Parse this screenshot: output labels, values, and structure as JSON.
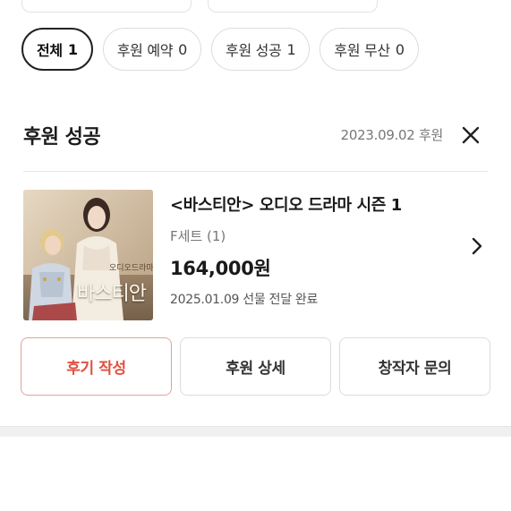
{
  "filter_tabs": [
    {
      "label": "전체",
      "count": "1",
      "active": true
    },
    {
      "label": "후원 예약",
      "count": "0",
      "active": false
    },
    {
      "label": "후원 성공",
      "count": "1",
      "active": false
    },
    {
      "label": "후원 무산",
      "count": "0",
      "active": false
    }
  ],
  "section": {
    "title": "후원 성공",
    "date": "2023.09.02 후원",
    "close_icon": "close-icon"
  },
  "item": {
    "title": "<바스티안> 오디오 드라마 시즌 1",
    "option": "F세트 (1)",
    "price": "164,000원",
    "status": "2025.01.09 선물 전달 완료",
    "thumbnail_title": "바스티안",
    "thumbnail_subtitle": "오디오드라마",
    "chevron_icon": "chevron-right-icon"
  },
  "actions": {
    "review": "후기 작성",
    "detail": "후원 상세",
    "inquiry": "창작자 문의"
  },
  "colors": {
    "accent": "#e0503e",
    "accent_border": "#e0a39b",
    "text_primary": "#1a1a1a",
    "text_secondary": "#777777",
    "border": "#dcdcdc"
  }
}
